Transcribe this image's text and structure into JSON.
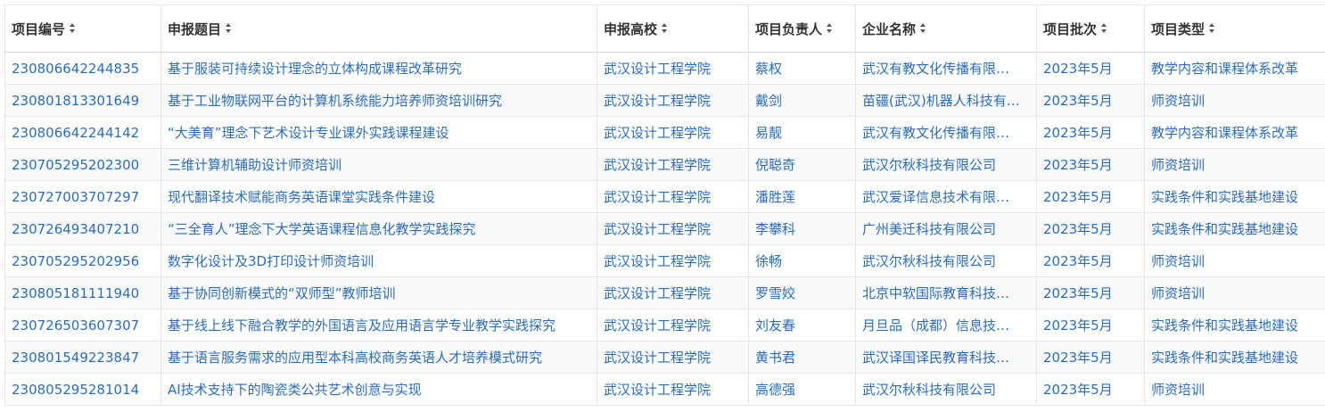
{
  "table": {
    "columns": [
      {
        "key": "project_id",
        "label": "项目编号"
      },
      {
        "key": "title",
        "label": "申报题目"
      },
      {
        "key": "school",
        "label": "申报高校"
      },
      {
        "key": "leader",
        "label": "项目负责人"
      },
      {
        "key": "company",
        "label": "企业名称"
      },
      {
        "key": "batch",
        "label": "项目批次"
      },
      {
        "key": "type",
        "label": "项目类型"
      }
    ],
    "rows": [
      {
        "project_id": "230806642244835",
        "title": "基于服装可持续设计理念的立体构成课程改革研究",
        "school": "武汉设计工程学院",
        "leader": "蔡权",
        "company": "武汉有教文化传播有限…",
        "batch": "2023年5月",
        "type": "教学内容和课程体系改革"
      },
      {
        "project_id": "230801813301649",
        "title": "基于工业物联网平台的计算机系统能力培养师资培训研究",
        "school": "武汉设计工程学院",
        "leader": "戴剑",
        "company": "苗疆(武汉)机器人科技有…",
        "batch": "2023年5月",
        "type": "师资培训"
      },
      {
        "project_id": "230806642244142",
        "title": "“大美育”理念下艺术设计专业课外实践课程建设",
        "school": "武汉设计工程学院",
        "leader": "易靓",
        "company": "武汉有教文化传播有限…",
        "batch": "2023年5月",
        "type": "教学内容和课程体系改革"
      },
      {
        "project_id": "230705295202300",
        "title": "三维计算机辅助设计师资培训",
        "school": "武汉设计工程学院",
        "leader": "倪聪奇",
        "company": "武汉尔秋科技有限公司",
        "batch": "2023年5月",
        "type": "师资培训"
      },
      {
        "project_id": "230727003707297",
        "title": "现代翻译技术赋能商务英语课堂实践条件建设",
        "school": "武汉设计工程学院",
        "leader": "潘胜莲",
        "company": "武汉爱译信息技术有限…",
        "batch": "2023年5月",
        "type": "实践条件和实践基地建设"
      },
      {
        "project_id": "230726493407210",
        "title": "“三全育人”理念下大学英语课程信息化教学实践探究",
        "school": "武汉设计工程学院",
        "leader": "李攀科",
        "company": "广州美迁科技有限公司",
        "batch": "2023年5月",
        "type": "实践条件和实践基地建设"
      },
      {
        "project_id": "230705295202956",
        "title": "数字化设计及3D打印设计师资培训",
        "school": "武汉设计工程学院",
        "leader": "徐畅",
        "company": "武汉尔秋科技有限公司",
        "batch": "2023年5月",
        "type": "师资培训"
      },
      {
        "project_id": "230805181111940",
        "title": "基于协同创新模式的“双师型”教师培训",
        "school": "武汉设计工程学院",
        "leader": "罗雪姣",
        "company": "北京中软国际教育科技…",
        "batch": "2023年5月",
        "type": "师资培训"
      },
      {
        "project_id": "230726503607307",
        "title": "基于线上线下融合教学的外国语言及应用语言学专业教学实践探究",
        "school": "武汉设计工程学院",
        "leader": "刘友春",
        "company": "月旦品（成都）信息技…",
        "batch": "2023年5月",
        "type": "实践条件和实践基地建设"
      },
      {
        "project_id": "230801549223847",
        "title": "基于语言服务需求的应用型本科高校商务英语人才培养模式研究",
        "school": "武汉设计工程学院",
        "leader": "黄书君",
        "company": "武汉译国译民教育科技…",
        "batch": "2023年5月",
        "type": "实践条件和实践基地建设"
      },
      {
        "project_id": "230805295281014",
        "title": "AI技术支持下的陶瓷类公共艺术创意与实现",
        "school": "武汉设计工程学院",
        "leader": "高德强",
        "company": "武汉尔秋科技有限公司",
        "batch": "2023年5月",
        "type": "师资培训"
      }
    ]
  }
}
